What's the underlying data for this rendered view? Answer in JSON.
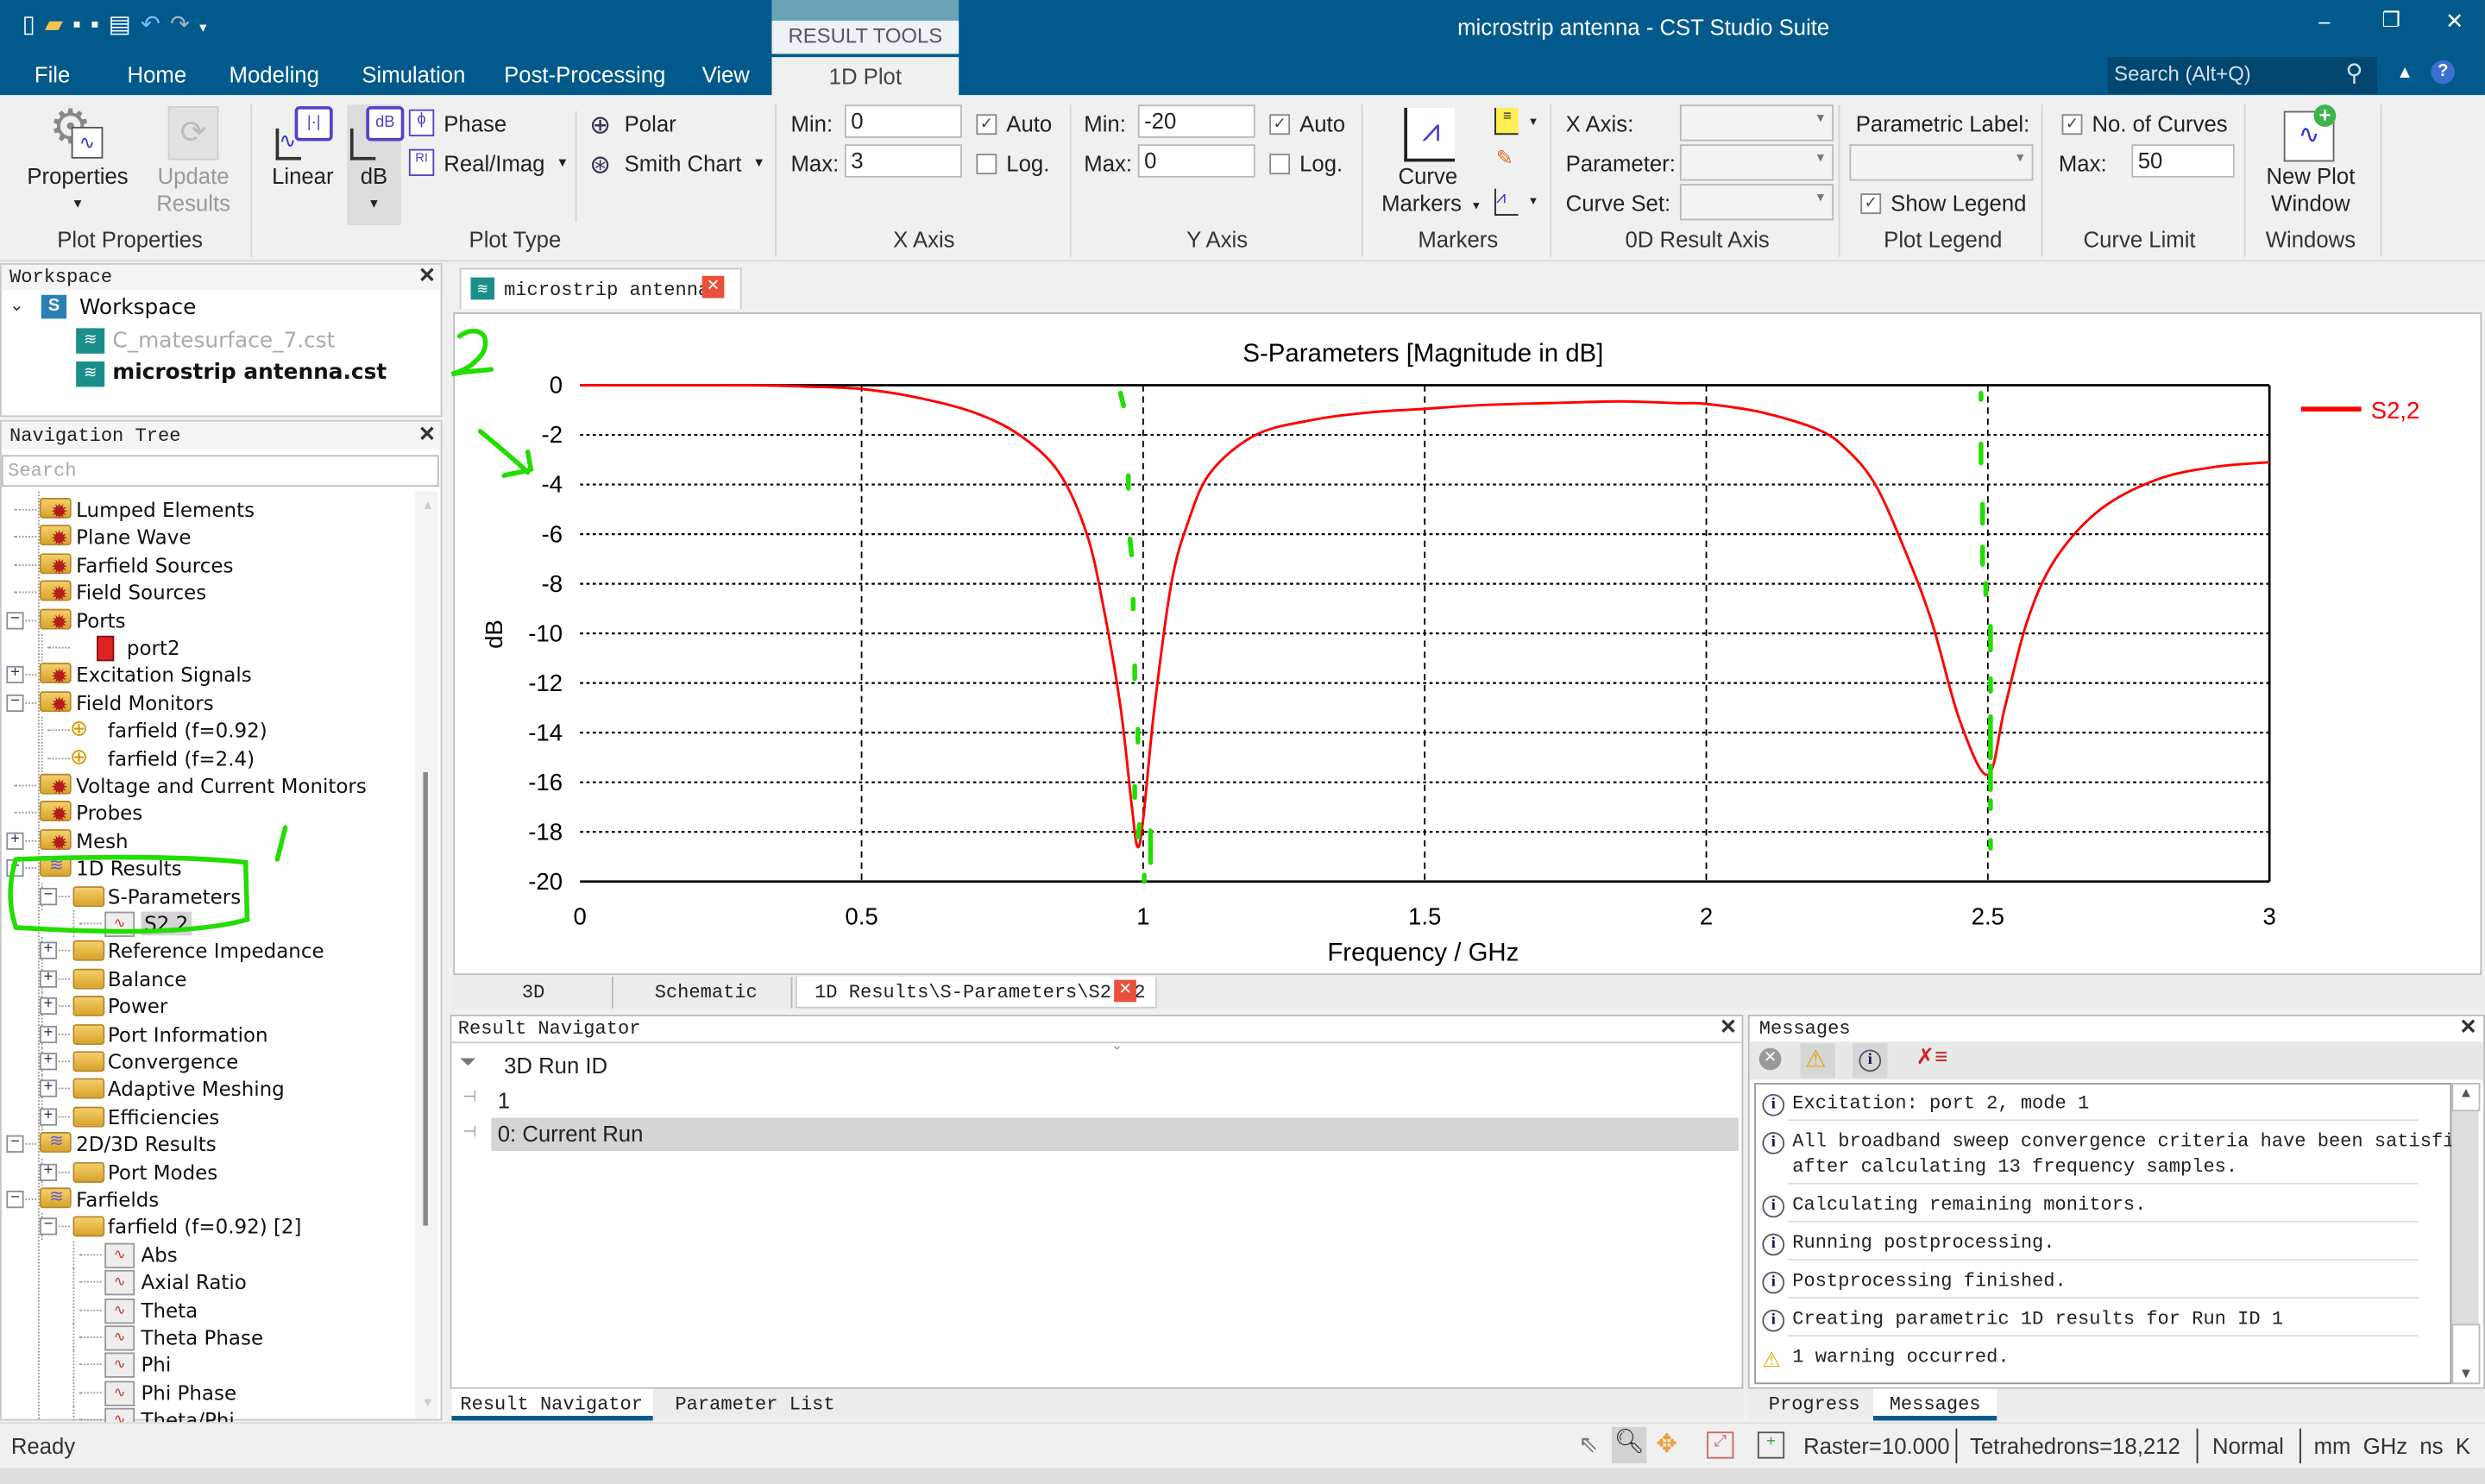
{
  "window": {
    "title": "microstrip antenna - CST Studio Suite",
    "search_placeholder": "Search (Alt+Q)"
  },
  "menu_tabs": [
    "File",
    "Home",
    "Modeling",
    "Simulation",
    "Post-Processing",
    "View"
  ],
  "context_tab": {
    "group": "RESULT TOOLS",
    "tab": "1D Plot"
  },
  "ribbon": {
    "plot_properties": {
      "properties": "Properties",
      "update_1": "Update",
      "update_2": "Results",
      "group": "Plot Properties"
    },
    "plot_type": {
      "linear": "Linear",
      "db": "dB",
      "phase": "Phase",
      "real_imag": "Real/Imag",
      "polar": "Polar",
      "smith": "Smith Chart",
      "group": "Plot Type"
    },
    "x_axis": {
      "min_label": "Min:",
      "min": "0",
      "max_label": "Max:",
      "max": "3",
      "auto": "Auto",
      "auto_checked": true,
      "log": "Log.",
      "log_checked": false,
      "group": "X Axis"
    },
    "y_axis": {
      "min_label": "Min:",
      "min": "-20",
      "max_label": "Max:",
      "max": "0",
      "auto": "Auto",
      "auto_checked": true,
      "log": "Log.",
      "log_checked": false,
      "group": "Y Axis"
    },
    "markers": {
      "curve_1": "Curve",
      "curve_2": "Markers",
      "group": "Markers"
    },
    "od_axis": {
      "x_axis": "X Axis:",
      "parameter": "Parameter:",
      "curve_set": "Curve Set:",
      "group": "0D Result Axis"
    },
    "plot_legend": {
      "parametric_label": "Parametric Label:",
      "show_legend": "Show Legend",
      "show_legend_checked": true,
      "group": "Plot Legend"
    },
    "curve_limit": {
      "no_of_curves": "No. of Curves",
      "checked": true,
      "max_label": "Max:",
      "max": "50",
      "group": "Curve Limit"
    },
    "windows": {
      "new_1": "New Plot",
      "new_2": "Window",
      "group": "Windows"
    }
  },
  "workspace": {
    "header": "Workspace",
    "root": "Workspace",
    "files": [
      {
        "name": "C_matesurface_7.cst",
        "active": false
      },
      {
        "name": "microstrip antenna.cst",
        "active": true
      }
    ]
  },
  "nav_tree": {
    "header": "Navigation Tree",
    "search_placeholder": "Search",
    "items": [
      {
        "label": "Lumped Elements",
        "level": 0,
        "icon": "gear-folder"
      },
      {
        "label": "Plane Wave",
        "level": 0,
        "icon": "gear-folder"
      },
      {
        "label": "Farfield Sources",
        "level": 0,
        "icon": "gear-folder"
      },
      {
        "label": "Field Sources",
        "level": 0,
        "icon": "gear-folder"
      },
      {
        "label": "Ports",
        "level": 0,
        "icon": "gear-folder",
        "expander": "-"
      },
      {
        "label": "port2",
        "level": 1,
        "icon": "port"
      },
      {
        "label": "Excitation Signals",
        "level": 0,
        "icon": "gear-folder",
        "expander": "+"
      },
      {
        "label": "Field Monitors",
        "level": 0,
        "icon": "gear-folder",
        "expander": "-"
      },
      {
        "label": "farfield (f=0.92)",
        "level": 1,
        "icon": "farfield-monitor"
      },
      {
        "label": "farfield (f=2.4)",
        "level": 1,
        "icon": "farfield-monitor"
      },
      {
        "label": "Voltage and Current Monitors",
        "level": 0,
        "icon": "gear-folder"
      },
      {
        "label": "Probes",
        "level": 0,
        "icon": "gear-folder"
      },
      {
        "label": "Mesh",
        "level": 0,
        "icon": "gear-folder",
        "expander": "+"
      },
      {
        "label": "1D Results",
        "level": 0,
        "icon": "results-folder",
        "expander": "-"
      },
      {
        "label": "S-Parameters",
        "level": 1,
        "icon": "folder",
        "expander": "-"
      },
      {
        "label": "S2,2",
        "level": 2,
        "icon": "curve",
        "selected": true
      },
      {
        "label": "Reference Impedance",
        "level": 1,
        "icon": "folder",
        "expander": "+"
      },
      {
        "label": "Balance",
        "level": 1,
        "icon": "folder",
        "expander": "+"
      },
      {
        "label": "Power",
        "level": 1,
        "icon": "folder",
        "expander": "+"
      },
      {
        "label": "Port Information",
        "level": 1,
        "icon": "folder",
        "expander": "+"
      },
      {
        "label": "Convergence",
        "level": 1,
        "icon": "folder",
        "expander": "+"
      },
      {
        "label": "Adaptive Meshing",
        "level": 1,
        "icon": "folder",
        "expander": "+"
      },
      {
        "label": "Efficiencies",
        "level": 1,
        "icon": "folder",
        "expander": "+"
      },
      {
        "label": "2D/3D Results",
        "level": 0,
        "icon": "results-folder",
        "expander": "-"
      },
      {
        "label": "Port Modes",
        "level": 1,
        "icon": "folder",
        "expander": "+"
      },
      {
        "label": "Farfields",
        "level": 0,
        "icon": "results-folder",
        "expander": "-"
      },
      {
        "label": "farfield (f=0.92) [2]",
        "level": 1,
        "icon": "folder",
        "expander": "-"
      },
      {
        "label": "Abs",
        "level": 2,
        "icon": "curve"
      },
      {
        "label": "Axial Ratio",
        "level": 2,
        "icon": "curve"
      },
      {
        "label": "Theta",
        "level": 2,
        "icon": "curve"
      },
      {
        "label": "Theta Phase",
        "level": 2,
        "icon": "curve"
      },
      {
        "label": "Phi",
        "level": 2,
        "icon": "curve"
      },
      {
        "label": "Phi Phase",
        "level": 2,
        "icon": "curve"
      },
      {
        "label": "Theta/Phi",
        "level": 2,
        "icon": "curve"
      }
    ]
  },
  "doc_tab": {
    "label": "microstrip antenna"
  },
  "view_tabs": [
    {
      "label": "3D",
      "active": false
    },
    {
      "label": "Schematic",
      "active": false
    },
    {
      "label": "1D Results\\S-Parameters\\S2, 2",
      "active": true
    }
  ],
  "chart_data": {
    "type": "line",
    "title": "S-Parameters [Magnitude in dB]",
    "xlabel": "Frequency / GHz",
    "ylabel": "dB",
    "xlim": [
      0,
      3
    ],
    "ylim": [
      -20,
      0
    ],
    "x_ticks": [
      "0",
      "0.5",
      "1",
      "1.5",
      "2",
      "2.5",
      "3"
    ],
    "y_ticks": [
      "0",
      "-2",
      "-4",
      "-6",
      "-8",
      "-10",
      "-12",
      "-14",
      "-16",
      "-18",
      "-20"
    ],
    "grid": true,
    "legend_position": "right",
    "series": [
      {
        "name": "S2,2",
        "color": "#ff0000",
        "x": [
          0,
          0.3,
          0.4,
          0.5,
          0.6,
          0.7,
          0.78,
          0.85,
          0.9,
          0.93,
          0.96,
          0.98,
          0.99,
          1.0,
          1.02,
          1.05,
          1.08,
          1.12,
          1.2,
          1.3,
          1.4,
          1.5,
          1.6,
          1.75,
          1.85,
          1.95,
          2.0,
          2.1,
          2.2,
          2.25,
          2.3,
          2.35,
          2.4,
          2.45,
          2.5,
          2.53,
          2.57,
          2.62,
          2.7,
          2.8,
          2.9,
          3.0
        ],
        "y": [
          0,
          0,
          -0.05,
          -0.15,
          -0.5,
          -1.1,
          -2,
          -3.5,
          -6,
          -9,
          -13,
          -17,
          -18.6,
          -17.5,
          -13,
          -8,
          -5.5,
          -3.5,
          -2,
          -1.4,
          -1.1,
          -0.95,
          -0.8,
          -0.7,
          -0.65,
          -0.72,
          -0.75,
          -1.1,
          -1.8,
          -2.6,
          -4,
          -6.5,
          -9.5,
          -13.5,
          -15.7,
          -13,
          -9.5,
          -7,
          -5,
          -3.8,
          -3.3,
          -3.1
        ]
      }
    ]
  },
  "result_navigator": {
    "header": "Result Navigator",
    "column": "3D Run ID",
    "rows": [
      "1",
      "0: Current Run"
    ],
    "tabs": [
      "Result Navigator",
      "Parameter List"
    ]
  },
  "messages": {
    "header": "Messages",
    "items": [
      {
        "type": "info",
        "text": "Excitation: port 2, mode 1"
      },
      {
        "type": "info",
        "text": "All broadband sweep convergence criteria have been satisfied",
        "text2": "after calculating 13 frequency samples."
      },
      {
        "type": "info",
        "text": "Calculating remaining monitors."
      },
      {
        "type": "info",
        "text": "Running postprocessing."
      },
      {
        "type": "info",
        "text": "Postprocessing finished."
      },
      {
        "type": "info",
        "text": "Creating parametric 1D results for Run ID 1"
      },
      {
        "type": "warning",
        "text": "1 warning occurred."
      }
    ],
    "tabs": [
      "Progress",
      "Messages"
    ]
  },
  "status_bar": {
    "state": "Ready",
    "raster": "Raster=10.000",
    "tetrahedrons": "Tetrahedrons=18,212",
    "mode": "Normal",
    "units": "mm  GHz  ns  K"
  },
  "annotation_color": "#22dd00"
}
